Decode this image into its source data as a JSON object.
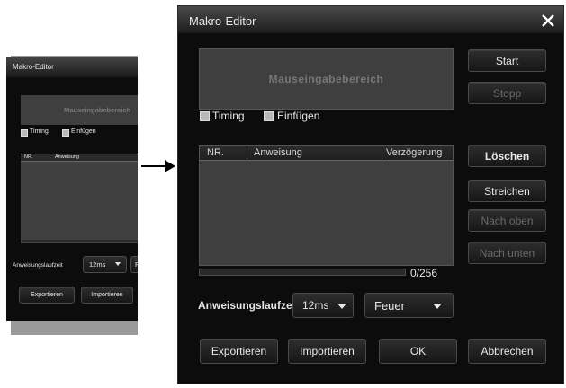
{
  "dialog": {
    "title": "Makro-Editor",
    "mouse_area_label": "Mauseingabebereich",
    "checkbox_timing": "Timing",
    "checkbox_insert": "Einfügen",
    "table": {
      "columns": [
        "NR.",
        "Anweisung",
        "Verzögerung"
      ]
    },
    "counter": "0/256",
    "runtime_label": "Anweisungslaufzeit",
    "runtime_value": "12ms",
    "mode_value": "Feuer",
    "buttons": {
      "start": "Start",
      "stop": "Stopp",
      "delete": "Löschen",
      "strike": "Streichen",
      "move_up": "Nach oben",
      "move_down": "Nach unten",
      "export": "Exportieren",
      "import": "Importieren",
      "ok": "OK",
      "cancel": "Abbrechen"
    }
  },
  "thumbnail": {
    "title": "Makro-Editor",
    "mouse_area_label": "Mauseingabebereich",
    "checkbox_timing": "Timing",
    "checkbox_insert": "Einfügen",
    "col_nr": "NR.",
    "col_instruction": "Anweisung",
    "runtime_label": "Anweisungslaufzeit",
    "runtime_value": "12ms",
    "mode_partial": "F",
    "export": "Exportieren",
    "import": "Importieren"
  },
  "colors": {
    "window_bg": "#0c0c0c",
    "panel_bg": "#3f3f3f",
    "accent_text": "#e8e8e8",
    "disabled_text": "#6a6a6a"
  },
  "icons": [
    "close-icon",
    "arrow-right-icon",
    "chevron-down-icon"
  ]
}
